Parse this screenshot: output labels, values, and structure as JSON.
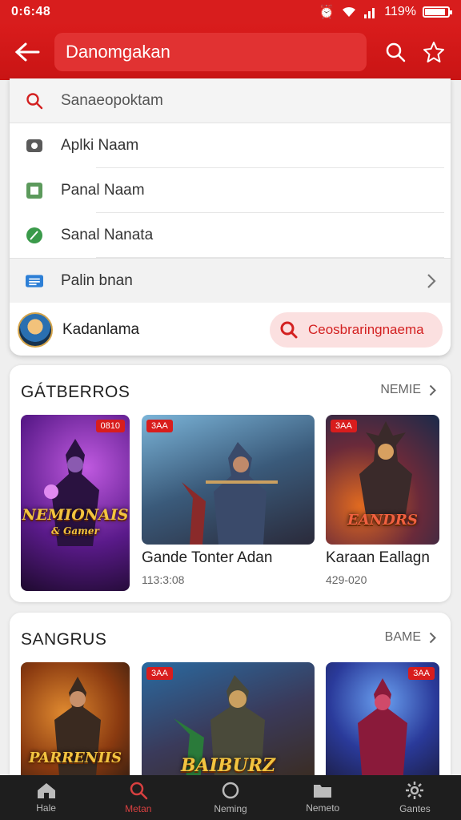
{
  "status": {
    "time": "0:6:48",
    "battery": "119%",
    "battery_fill": 0.9
  },
  "appbar": {
    "search_value": "Danomgakan"
  },
  "dropdown": {
    "search_placeholder": "Sanaeopoktam",
    "items": [
      {
        "label": "Aplki Naam",
        "icon": "app-icon"
      },
      {
        "label": "Panal Naam",
        "icon": "box-icon"
      },
      {
        "label": "Sanal Nanata",
        "icon": "leaf-icon"
      }
    ],
    "library_label": "Palin bnan",
    "user_name": "Kadanlama",
    "user_button": "Ceosbraringnaema"
  },
  "sections": [
    {
      "title": "GÁTBERROS",
      "more": "NEMIE",
      "cards": [
        {
          "badge": "0810",
          "logo": "NEMIONAIS",
          "logo_sub": "& Gamer",
          "title": "",
          "meta": ""
        },
        {
          "badge": "3AA",
          "logo": "",
          "title": "Gande Tonter Adan",
          "meta": "113:3:08"
        },
        {
          "badge": "3AA",
          "logo": "EANDRS",
          "title": "Karaan Eallagn",
          "meta": "429-020"
        }
      ]
    },
    {
      "title": "SANGRUS",
      "more": "BAME",
      "cards": [
        {
          "badge": "",
          "logo": "PARRENIIS",
          "title": "",
          "meta": ""
        },
        {
          "badge": "3AA",
          "logo": "BAIBURZ",
          "title": "",
          "meta": ""
        },
        {
          "badge": "3AA",
          "logo": "",
          "title": "",
          "meta": ""
        }
      ]
    }
  ],
  "nav": [
    {
      "label": "Hale",
      "icon": "home-icon"
    },
    {
      "label": "Metan",
      "icon": "search-icon"
    },
    {
      "label": "Neming",
      "icon": "circle-icon"
    },
    {
      "label": "Nemeto",
      "icon": "folder-icon"
    },
    {
      "label": "Gantes",
      "icon": "gear-icon"
    }
  ],
  "colors": {
    "brand": "#d81d1d",
    "accent_pill": "#fbe0e0",
    "nav_bg": "#1e1e1e"
  }
}
